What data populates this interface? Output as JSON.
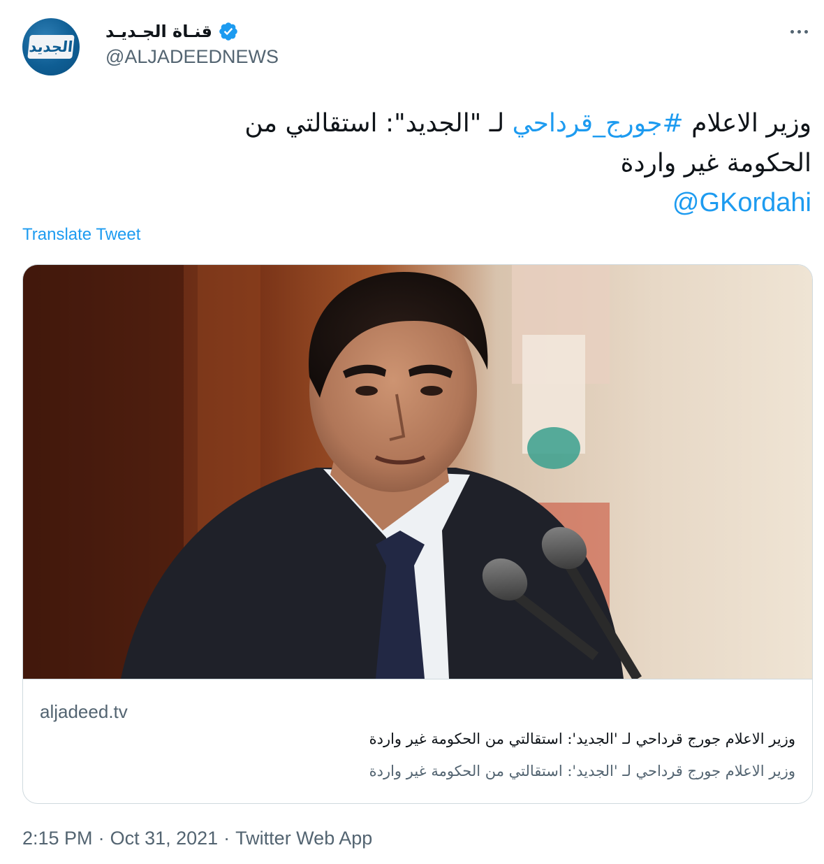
{
  "author": {
    "display_name": "قنـاة الجـديـد",
    "handle": "@ALJADEEDNEWS",
    "avatar_logo_text": "الجديد",
    "verified": true
  },
  "tweet": {
    "line1_before": "وزير الاعلام ",
    "hashtag": "#جورج_قرداحي",
    "line1_after": " لـ \"الجديد\": استقالتي من",
    "line2": "الحكومة غير واردة",
    "mention": "@GKordahi"
  },
  "translate_label": "Translate Tweet",
  "card": {
    "domain": "aljadeed.tv",
    "title": "وزير الاعلام جورج قرداحي لـ 'الجديد': استقالتي من الحكومة غير واردة",
    "description": "وزير الاعلام جورج قرداحي لـ 'الجديد': استقالتي من الحكومة غير واردة"
  },
  "meta": {
    "time": "2:15 PM",
    "separator": "·",
    "date": "Oct 31, 2021",
    "source": "Twitter Web App"
  },
  "colors": {
    "link": "#1d9bf0",
    "secondary_text": "#536471",
    "primary_text": "#0f1419",
    "border": "#cfd9de"
  },
  "icons": [
    "avatar",
    "verified-badge-icon",
    "more-options-icon"
  ]
}
